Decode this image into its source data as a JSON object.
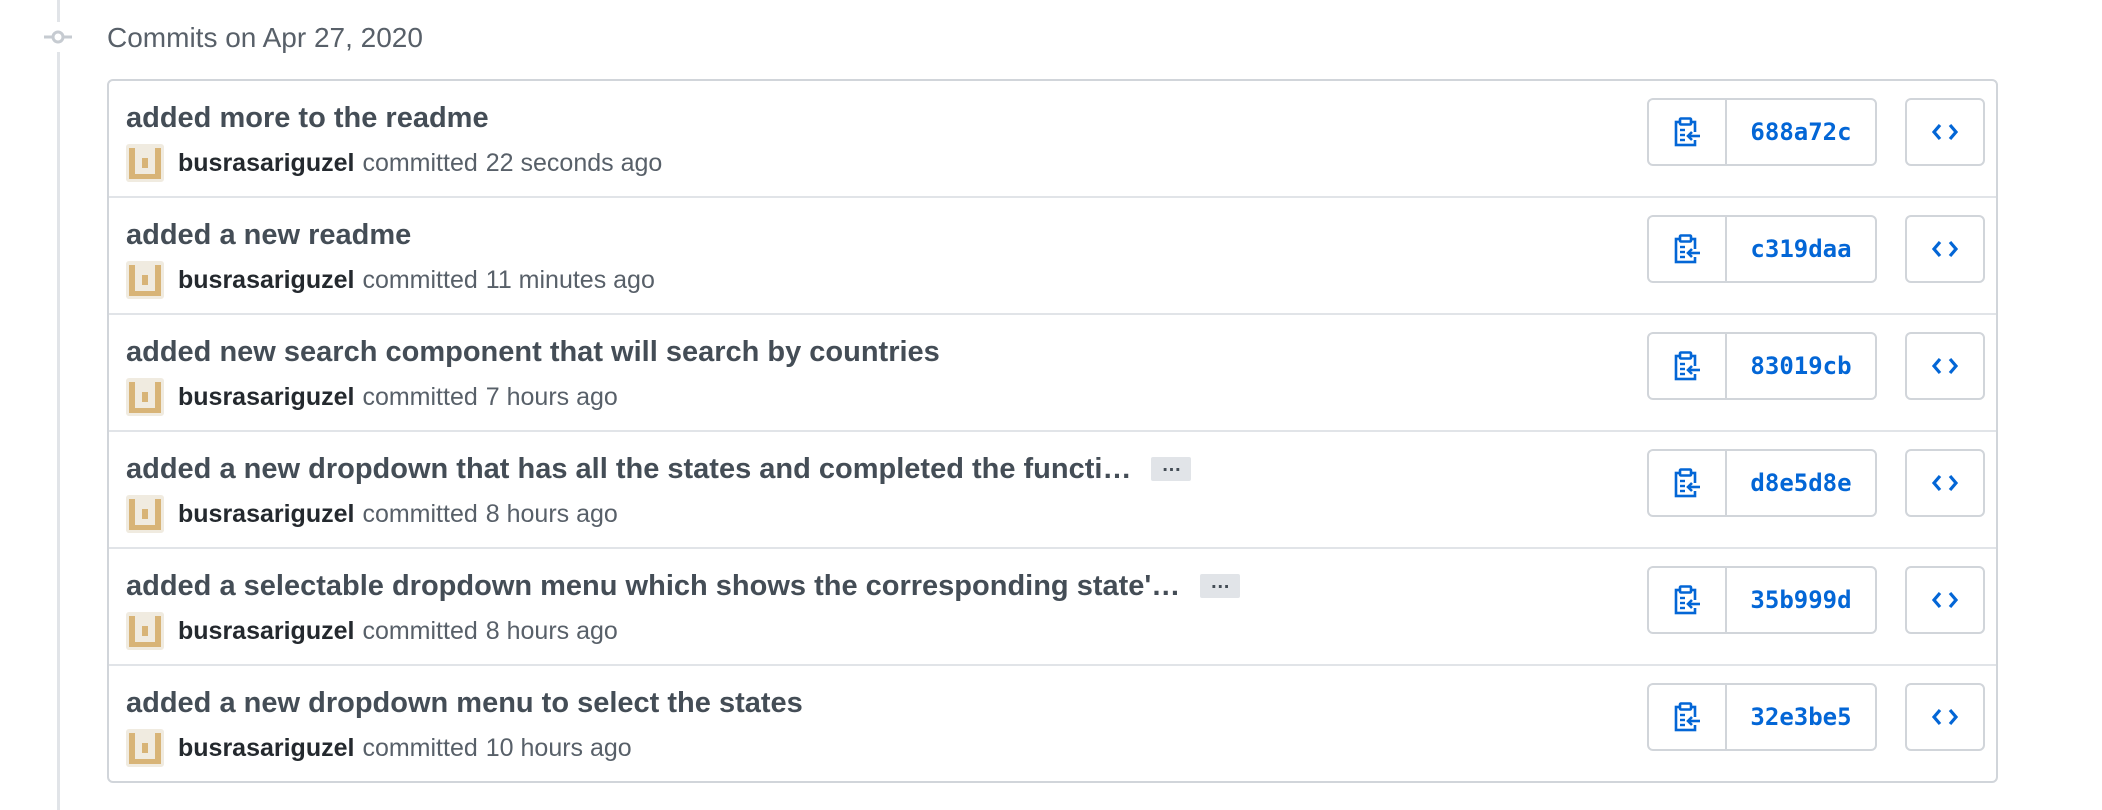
{
  "group": {
    "title": "Commits on Apr 27, 2020"
  },
  "colors": {
    "link": "#0366d6",
    "border": "#d1d5da",
    "muted": "#586069",
    "title": "#444d56"
  },
  "icons": {
    "timeline": "git-commit-icon",
    "copy": "clipboard-copy-icon",
    "browse": "code-icon",
    "ellipsis": "ellipsis-icon",
    "avatar": "identicon-avatar"
  },
  "commits": [
    {
      "title": "added more to the readme",
      "author": "busrasariguzel",
      "committed_label": "committed",
      "time": "22 seconds ago",
      "sha": "688a72c",
      "truncated": false,
      "ellipsis": ""
    },
    {
      "title": "added a new readme",
      "author": "busrasariguzel",
      "committed_label": "committed",
      "time": "11 minutes ago",
      "sha": "c319daa",
      "truncated": false,
      "ellipsis": ""
    },
    {
      "title": "added new search component that will search by countries",
      "author": "busrasariguzel",
      "committed_label": "committed",
      "time": "7 hours ago",
      "sha": "83019cb",
      "truncated": false,
      "ellipsis": ""
    },
    {
      "title": "added a new dropdown that has all the states and completed the functi…",
      "author": "busrasariguzel",
      "committed_label": "committed",
      "time": "8 hours ago",
      "sha": "d8e5d8e",
      "truncated": true,
      "ellipsis": "…"
    },
    {
      "title": "added a selectable dropdown menu which shows the corresponding state'…",
      "author": "busrasariguzel",
      "committed_label": "committed",
      "time": "8 hours ago",
      "sha": "35b999d",
      "truncated": true,
      "ellipsis": "…"
    },
    {
      "title": "added a new dropdown menu to select the states",
      "author": "busrasariguzel",
      "committed_label": "committed",
      "time": "10 hours ago",
      "sha": "32e3be5",
      "truncated": false,
      "ellipsis": ""
    }
  ]
}
